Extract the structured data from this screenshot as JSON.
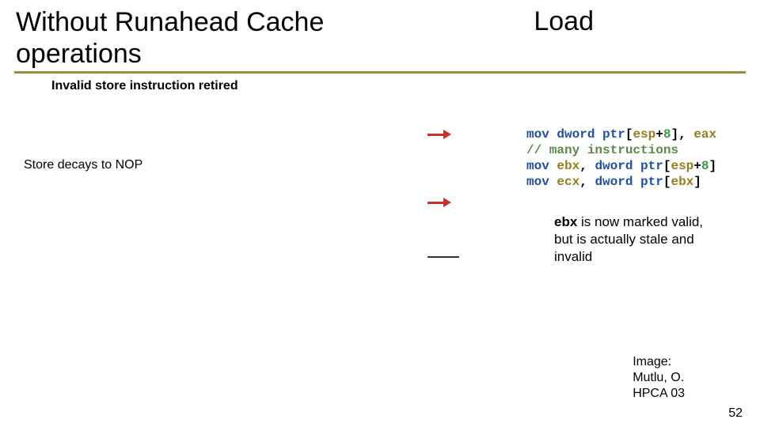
{
  "title_left_line1": "Without Runahead Cache",
  "title_left_line2": "operations",
  "title_right": "Load",
  "subtitle": "Invalid store instruction retired",
  "store_nop": "Store decays to NOP",
  "code": {
    "l1": {
      "a": "mov",
      "b": " ",
      "c": "dword ptr",
      "d": "[",
      "e": "esp",
      "f": "+",
      "g": "8",
      "h": "], ",
      "i": "eax"
    },
    "l2": "// many instructions",
    "l3": {
      "a": "mov",
      "b": " ",
      "c": "ebx",
      "d": ", ",
      "e": "dword ptr",
      "f": "[",
      "g": "esp",
      "h": "+",
      "i": "8",
      "j": "]"
    },
    "l4": {
      "a": "mov",
      "b": " ",
      "c": "ecx",
      "d": ", ",
      "e": "dword ptr",
      "f": "[",
      "g": "ebx",
      "h": "]"
    }
  },
  "callout": {
    "reg": "ebx",
    "rest": " is now marked valid, but is actually stale and invalid"
  },
  "credit_l1": "Image:",
  "credit_l2": "Mutlu, O.",
  "credit_l3": "HPCA 03",
  "pagenum": "52"
}
